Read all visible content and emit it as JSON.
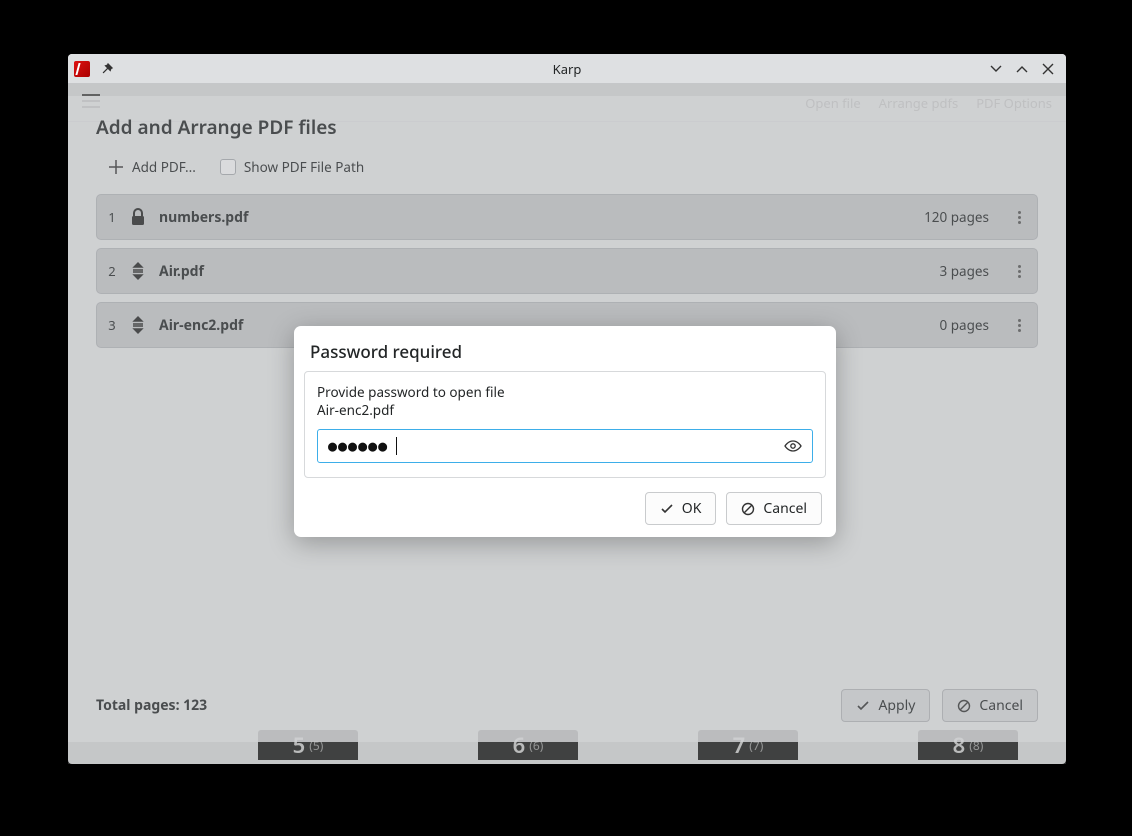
{
  "window": {
    "title": "Karp"
  },
  "toolbar_bg": {
    "item1": "Open file",
    "item2": "Arrange pdfs",
    "item3": "PDF Options"
  },
  "thumbs": {
    "a": {
      "n": "5",
      "s": "(5)"
    },
    "b": {
      "n": "6",
      "s": "(6)"
    },
    "c": {
      "n": "7",
      "s": "(7)"
    },
    "d": {
      "n": "8",
      "s": "(8)"
    }
  },
  "arrange": {
    "title": "Add and Arrange PDF files",
    "add_label": "Add PDF...",
    "show_path_label": "Show PDF File Path",
    "files": [
      {
        "index": "1",
        "name": "numbers.pdf",
        "pages": "120 pages",
        "icon": "lock"
      },
      {
        "index": "2",
        "name": "Air.pdf",
        "pages": "3 pages",
        "icon": "drag"
      },
      {
        "index": "3",
        "name": "Air-enc2.pdf",
        "pages": "0 pages",
        "icon": "drag"
      }
    ],
    "total_label": "Total pages: 123",
    "apply_label": "Apply",
    "cancel_label": "Cancel"
  },
  "password_dialog": {
    "title": "Password required",
    "prompt_line1": "Provide password to open file",
    "prompt_line2": "Air-enc2.pdf",
    "masked_value": "●●●●●●",
    "ok_label": "OK",
    "cancel_label": "Cancel"
  }
}
